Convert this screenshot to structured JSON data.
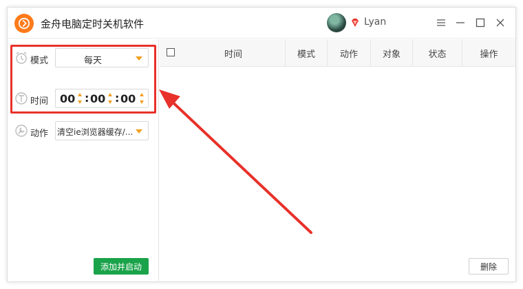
{
  "app": {
    "title": "金舟电脑定时关机软件",
    "brand_color": "#ff7a1a"
  },
  "user": {
    "name": "Lyan"
  },
  "titlebar": {
    "icons": [
      "settings-icon",
      "minimize-icon",
      "maximize-icon",
      "close-icon"
    ]
  },
  "form": {
    "mode_label": "模式",
    "mode_value": "每天",
    "time_label": "时间",
    "time": {
      "hours": "00",
      "minutes": "00",
      "seconds": "00"
    },
    "action_label": "动作",
    "action_value": "清空ie浏览器缓存/...",
    "add_button": "添加并启动"
  },
  "table": {
    "columns": [
      "时间",
      "模式",
      "动作",
      "对象",
      "状态",
      "操作"
    ],
    "rows": []
  },
  "delete_button": "删除",
  "colors": {
    "accent": "#f0a020",
    "highlight": "#e8312a",
    "primary_button": "#1aa34a"
  }
}
